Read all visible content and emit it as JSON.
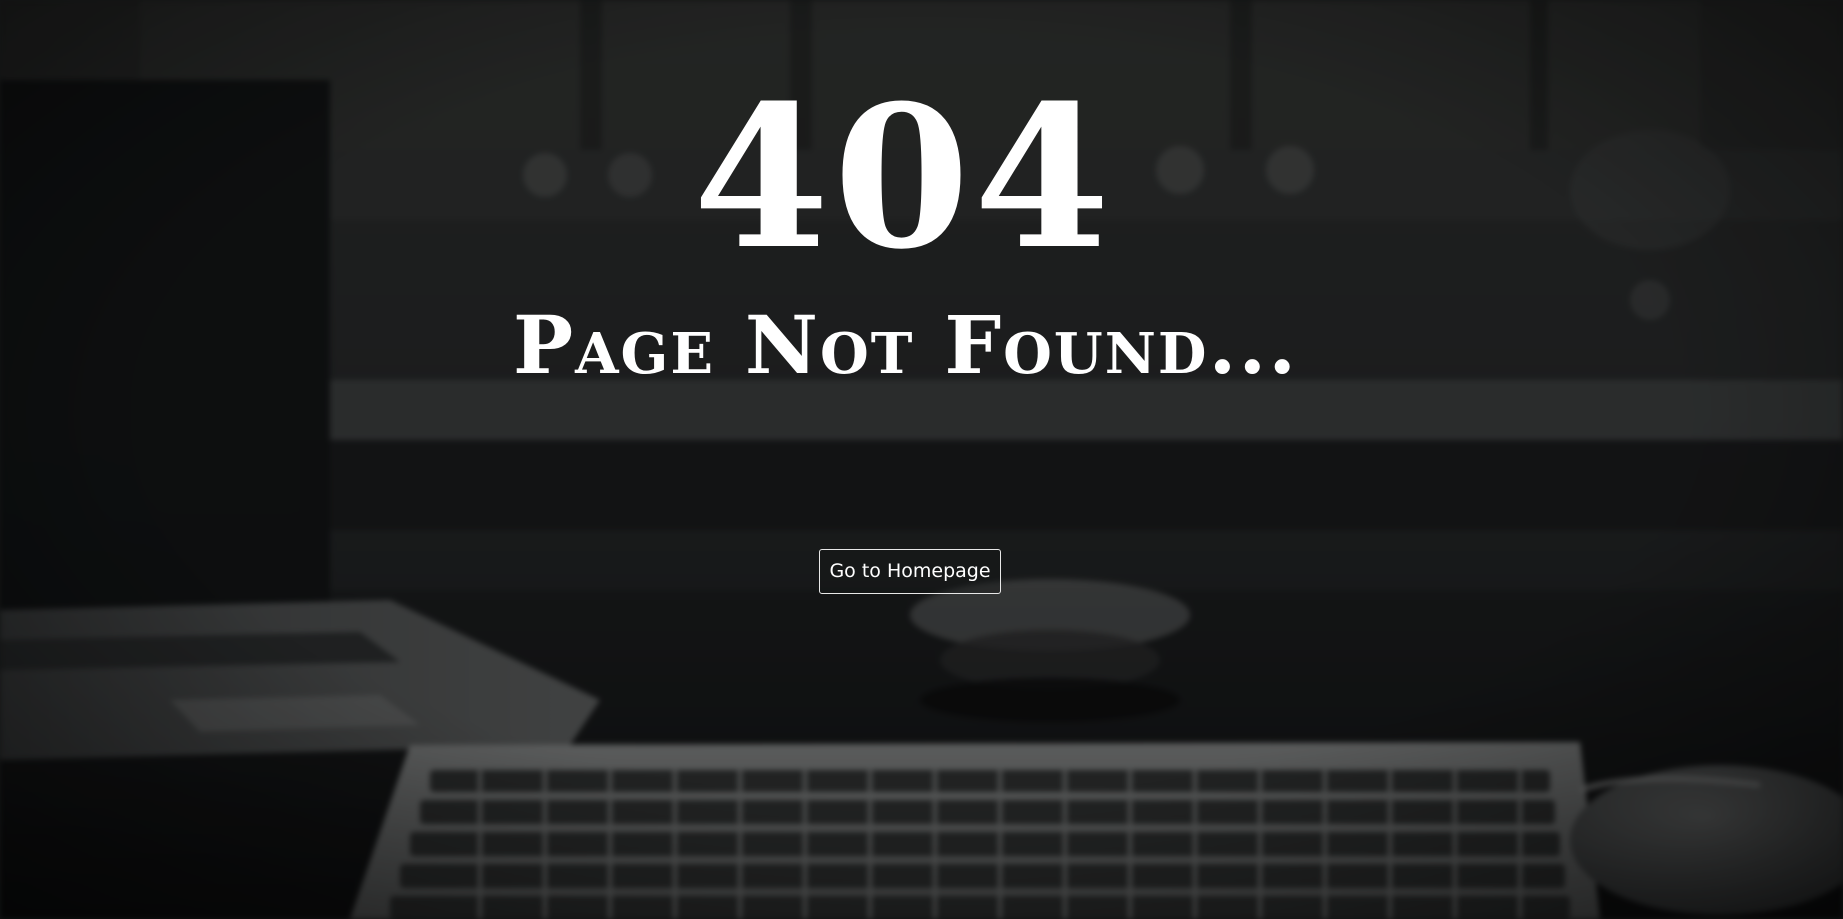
{
  "page": {
    "error_code": "404",
    "error_message": "Page Not Found...",
    "home_button_label": "Go to Homepage"
  },
  "background": {
    "description_icon": "desk-photo-laptop-keyboard-mouse"
  },
  "colors": {
    "text": "#ffffff",
    "button_border": "#e8e8e8",
    "background": "#1a1c1d"
  }
}
